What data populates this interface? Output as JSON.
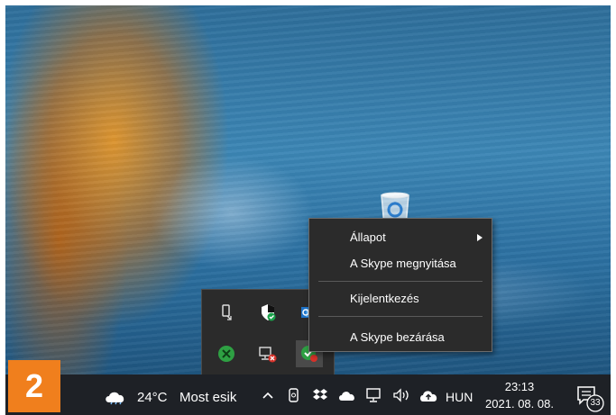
{
  "badge": "2",
  "context_menu": {
    "items": [
      {
        "label": "Állapot"
      },
      {
        "label": "A Skype megnyitása"
      },
      {
        "label": "Kijelentkezés"
      },
      {
        "label": "A Skype bezárása"
      }
    ]
  },
  "taskbar": {
    "weather_temp": "24°C",
    "weather_text": "Most esik",
    "language": "HUN",
    "time": "23:13",
    "date": "2021. 08. 08.",
    "notification_count": "33"
  },
  "colors": {
    "badge": "#f07f1d",
    "menu_bg": "#2b2b2b",
    "taskbar_bg": "#1e2126"
  }
}
